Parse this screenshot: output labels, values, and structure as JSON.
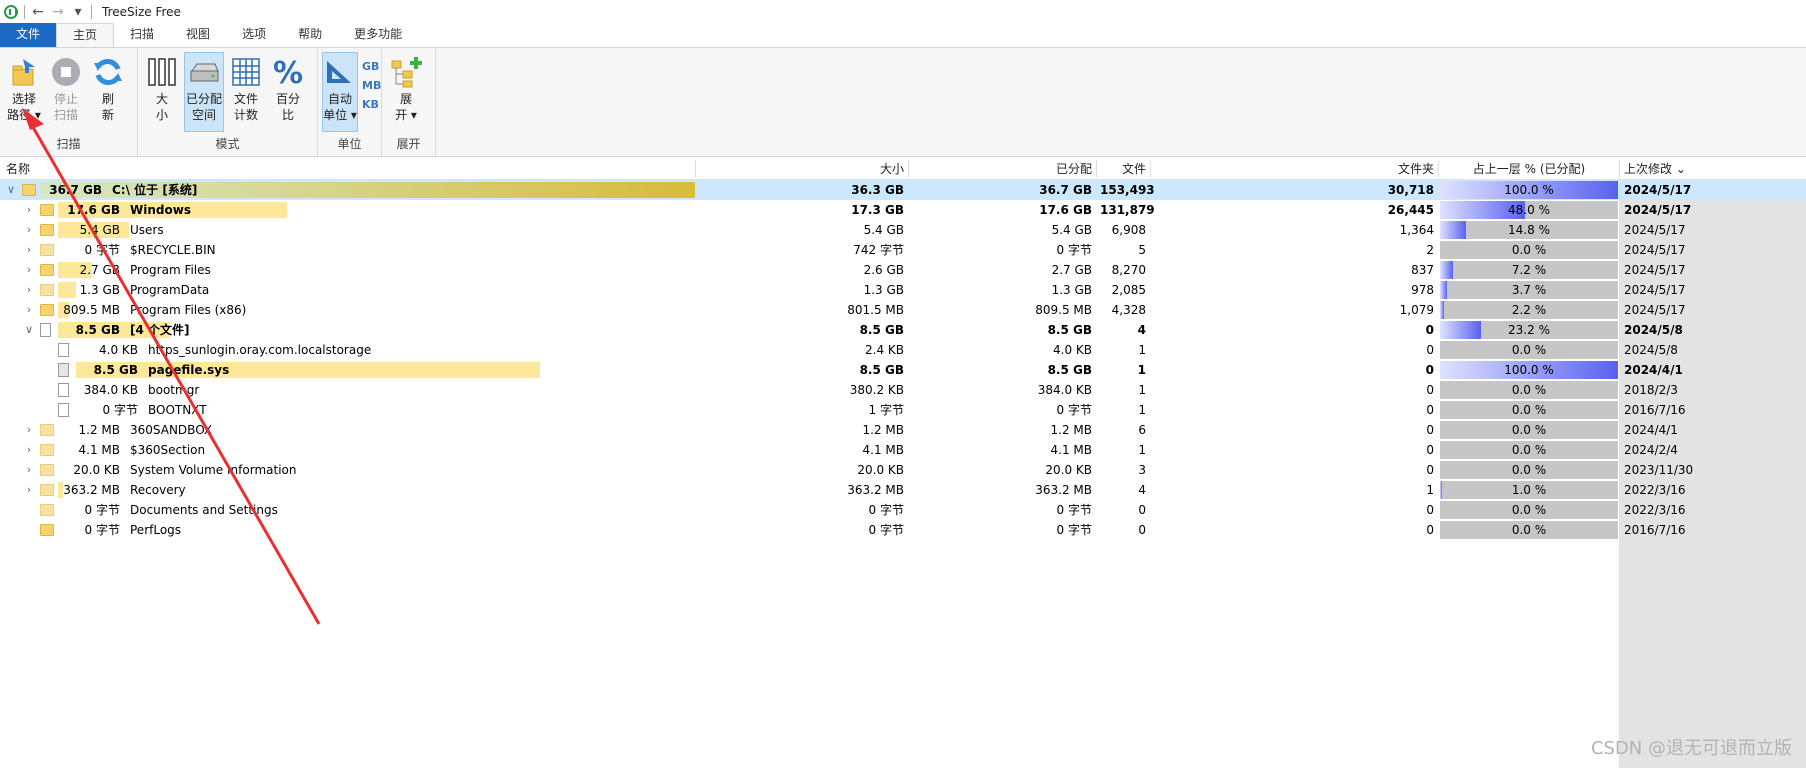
{
  "window": {
    "title": "TreeSize Free"
  },
  "tabs": [
    {
      "label": "文件",
      "kind": "file"
    },
    {
      "label": "主页",
      "kind": "active"
    },
    {
      "label": "扫描",
      "kind": ""
    },
    {
      "label": "视图",
      "kind": ""
    },
    {
      "label": "选项",
      "kind": ""
    },
    {
      "label": "帮助",
      "kind": ""
    },
    {
      "label": "更多功能",
      "kind": ""
    }
  ],
  "ribbon": {
    "scan": {
      "label": "扫描",
      "select_path": "选择\n路径 ▾",
      "stop_scan": "停止\n扫描",
      "refresh": "刷\n新"
    },
    "mode": {
      "label": "模式",
      "size": "大\n小",
      "allocated": "已分配\n空间",
      "file_count": "文件\n计数",
      "percent": "百分\n比"
    },
    "unit": {
      "label": "单位",
      "auto": "自动\n单位 ▾",
      "gb": "GB",
      "mb": "MB",
      "kb": "KB"
    },
    "expand": {
      "label": "展开",
      "expand": "展\n开 ▾"
    }
  },
  "columns": {
    "name": "名称",
    "size": "大小",
    "allocated": "已分配",
    "files": "文件",
    "folders": "文件夹",
    "percent": "占上一层 % (已分配)",
    "modified": "上次修改 ⌄"
  },
  "rows": [
    {
      "level": 0,
      "exp": "∨",
      "icon": "folder",
      "size_label": "36.7 GB",
      "name": "C:\\  位于  [系统]",
      "size": "36.3 GB",
      "alloc": "36.7 GB",
      "files": "153,493",
      "folders": "30,718",
      "pct": 100,
      "pct_label": "100.0 %",
      "date": "2024/5/17",
      "bold": true,
      "selected": true,
      "bar": 1.0
    },
    {
      "level": 1,
      "exp": "›",
      "icon": "folder",
      "size_label": "17.6 GB",
      "name": "Windows",
      "size": "17.3 GB",
      "alloc": "17.6 GB",
      "files": "131,879",
      "folders": "26,445",
      "pct": 48,
      "pct_label": "48.0 %",
      "date": "2024/5/17",
      "bold": true,
      "selected": false,
      "bar": 0.48
    },
    {
      "level": 1,
      "exp": "›",
      "icon": "folder",
      "size_label": "5.4 GB",
      "name": "Users",
      "size": "5.4 GB",
      "alloc": "5.4 GB",
      "files": "6,908",
      "folders": "1,364",
      "pct": 14.8,
      "pct_label": "14.8 %",
      "date": "2024/5/17",
      "bold": false,
      "selected": false,
      "bar": 0.148
    },
    {
      "level": 1,
      "exp": "›",
      "icon": "folder-small",
      "size_label": "0 字节",
      "name": "$RECYCLE.BIN",
      "size": "742 字节",
      "alloc": "0 字节",
      "files": "5",
      "folders": "2",
      "pct": 0,
      "pct_label": "0.0 %",
      "date": "2024/5/17",
      "bold": false,
      "selected": false,
      "bar": 0
    },
    {
      "level": 1,
      "exp": "›",
      "icon": "folder",
      "size_label": "2.7 GB",
      "name": "Program Files",
      "size": "2.6 GB",
      "alloc": "2.7 GB",
      "files": "8,270",
      "folders": "837",
      "pct": 7.2,
      "pct_label": "7.2 %",
      "date": "2024/5/17",
      "bold": false,
      "selected": false,
      "bar": 0.072
    },
    {
      "level": 1,
      "exp": "›",
      "icon": "folder-small",
      "size_label": "1.3 GB",
      "name": "ProgramData",
      "size": "1.3 GB",
      "alloc": "1.3 GB",
      "files": "2,085",
      "folders": "978",
      "pct": 3.7,
      "pct_label": "3.7 %",
      "date": "2024/5/17",
      "bold": false,
      "selected": false,
      "bar": 0.037
    },
    {
      "level": 1,
      "exp": "›",
      "icon": "folder",
      "size_label": "809.5 MB",
      "name": "Program Files (x86)",
      "size": "801.5 MB",
      "alloc": "809.5 MB",
      "files": "4,328",
      "folders": "1,079",
      "pct": 2.2,
      "pct_label": "2.2 %",
      "date": "2024/5/17",
      "bold": false,
      "selected": false,
      "bar": 0.022
    },
    {
      "level": 1,
      "exp": "∨",
      "icon": "file",
      "size_label": "8.5 GB",
      "name": "[4 个文件]",
      "size": "8.5 GB",
      "alloc": "8.5 GB",
      "files": "4",
      "folders": "0",
      "pct": 23.2,
      "pct_label": "23.2 %",
      "date": "2024/5/8",
      "bold": true,
      "selected": false,
      "bar": 0.232
    },
    {
      "level": 2,
      "exp": "",
      "icon": "file",
      "size_label": "4.0 KB",
      "name": "https_sunlogin.oray.com.localstorage",
      "size": "2.4 KB",
      "alloc": "4.0 KB",
      "files": "1",
      "folders": "0",
      "pct": 0,
      "pct_label": "0.0 %",
      "date": "2024/5/8",
      "bold": false,
      "selected": false,
      "bar": 0
    },
    {
      "level": 2,
      "exp": "",
      "icon": "file-dim",
      "size_label": "8.5 GB",
      "name": "pagefile.sys",
      "size": "8.5 GB",
      "alloc": "8.5 GB",
      "files": "1",
      "folders": "0",
      "pct": 100,
      "pct_label": "100.0 %",
      "date": "2024/4/1",
      "bold": true,
      "selected": false,
      "bar": 1.0
    },
    {
      "level": 2,
      "exp": "",
      "icon": "file",
      "size_label": "384.0 KB",
      "name": "bootmgr",
      "size": "380.2 KB",
      "alloc": "384.0 KB",
      "files": "1",
      "folders": "0",
      "pct": 0,
      "pct_label": "0.0 %",
      "date": "2018/2/3",
      "bold": false,
      "selected": false,
      "bar": 0
    },
    {
      "level": 2,
      "exp": "",
      "icon": "file",
      "size_label": "0 字节",
      "name": "BOOTNXT",
      "size": "1 字节",
      "alloc": "0 字节",
      "files": "1",
      "folders": "0",
      "pct": 0,
      "pct_label": "0.0 %",
      "date": "2016/7/16",
      "bold": false,
      "selected": false,
      "bar": 0
    },
    {
      "level": 1,
      "exp": "›",
      "icon": "folder-small",
      "size_label": "1.2 MB",
      "name": "360SANDBOX",
      "size": "1.2 MB",
      "alloc": "1.2 MB",
      "files": "6",
      "folders": "0",
      "pct": 0,
      "pct_label": "0.0 %",
      "date": "2024/4/1",
      "bold": false,
      "selected": false,
      "bar": 0
    },
    {
      "level": 1,
      "exp": "›",
      "icon": "folder-small",
      "size_label": "4.1 MB",
      "name": "$360Section",
      "size": "4.1 MB",
      "alloc": "4.1 MB",
      "files": "1",
      "folders": "0",
      "pct": 0,
      "pct_label": "0.0 %",
      "date": "2024/2/4",
      "bold": false,
      "selected": false,
      "bar": 0
    },
    {
      "level": 1,
      "exp": "›",
      "icon": "folder-small",
      "size_label": "20.0 KB",
      "name": "System Volume Information",
      "size": "20.0 KB",
      "alloc": "20.0 KB",
      "files": "3",
      "folders": "0",
      "pct": 0,
      "pct_label": "0.0 %",
      "date": "2023/11/30",
      "bold": false,
      "selected": false,
      "bar": 0
    },
    {
      "level": 1,
      "exp": "›",
      "icon": "folder-small",
      "size_label": "363.2 MB",
      "name": "Recovery",
      "size": "363.2 MB",
      "alloc": "363.2 MB",
      "files": "4",
      "folders": "1",
      "pct": 1,
      "pct_label": "1.0 %",
      "date": "2022/3/16",
      "bold": false,
      "selected": false,
      "bar": 0.01
    },
    {
      "level": 1,
      "exp": "",
      "icon": "folder-small",
      "size_label": "0 字节",
      "name": "Documents and Settings",
      "size": "0 字节",
      "alloc": "0 字节",
      "files": "0",
      "folders": "0",
      "pct": 0,
      "pct_label": "0.0 %",
      "date": "2022/3/16",
      "bold": false,
      "selected": false,
      "bar": 0
    },
    {
      "level": 1,
      "exp": "",
      "icon": "folder",
      "size_label": "0 字节",
      "name": "PerfLogs",
      "size": "0 字节",
      "alloc": "0 字节",
      "files": "0",
      "folders": "0",
      "pct": 0,
      "pct_label": "0.0 %",
      "date": "2016/7/16",
      "bold": false,
      "selected": false,
      "bar": 0
    }
  ],
  "watermark": "CSDN @退无可退而立版",
  "colors": {
    "file_tab": "#1b6ac6",
    "selected_row": "#cce8ff",
    "name_bar": "#fde89a",
    "pct_fill": "#5861ef",
    "annotation_arrow": "#e83030"
  }
}
